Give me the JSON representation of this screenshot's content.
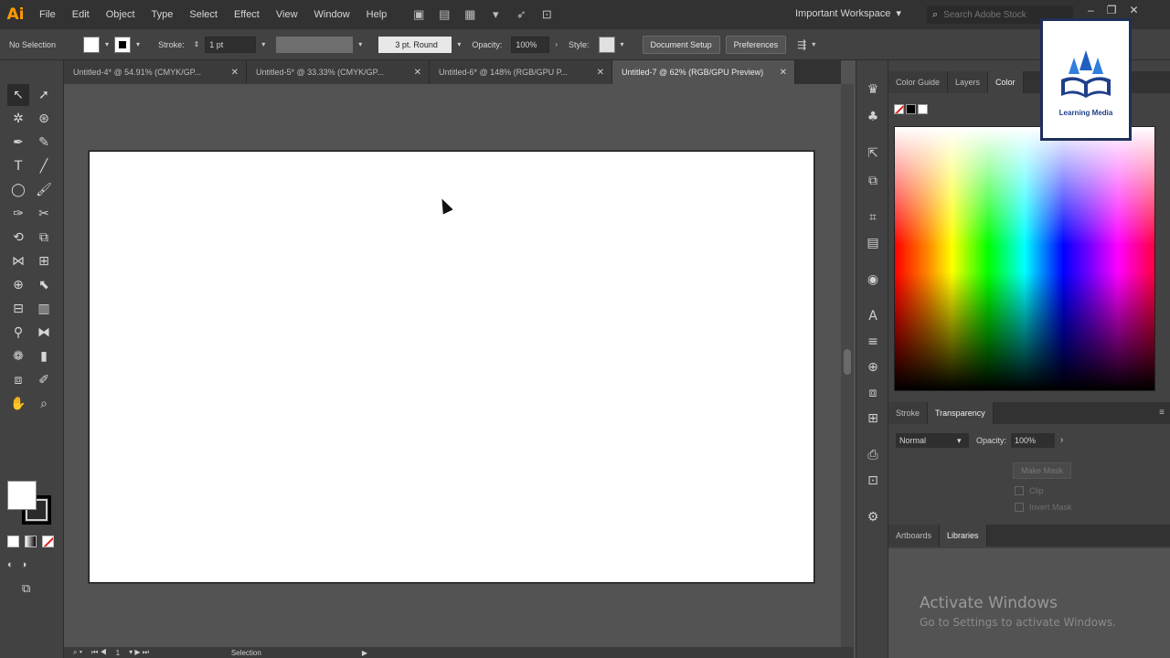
{
  "app": {
    "logo_text": "Ai"
  },
  "menu": {
    "items": [
      "File",
      "Edit",
      "Object",
      "Type",
      "Select",
      "Effect",
      "View",
      "Window",
      "Help"
    ]
  },
  "workspace": {
    "label": "Important Workspace"
  },
  "stock_search": {
    "placeholder": "Search Adobe Stock"
  },
  "control_bar": {
    "selection_label": "No Selection",
    "stroke_label": "Stroke:",
    "stroke_value": "1 pt",
    "profile_label": "3 pt. Round",
    "opacity_label": "Opacity:",
    "opacity_value": "100%",
    "style_label": "Style:",
    "document_setup": "Document Setup",
    "preferences": "Preferences"
  },
  "tabs": [
    {
      "label": "Untitled-4* @ 54.91% (CMYK/GP...",
      "active": false
    },
    {
      "label": "Untitled-5* @ 33.33% (CMYK/GP...",
      "active": false
    },
    {
      "label": "Untitled-6* @ 148% (RGB/GPU P...",
      "active": false
    },
    {
      "label": "Untitled-7 @ 62% (RGB/GPU Preview)",
      "active": true
    }
  ],
  "color_panel": {
    "tabs": [
      "Color Guide",
      "Layers",
      "Color"
    ],
    "active_tab": "Color"
  },
  "transparency_panel": {
    "tabs": [
      "Stroke",
      "Transparency"
    ],
    "blend_mode": "Normal",
    "opacity_label": "Opacity:",
    "opacity_value": "100%",
    "make_mask": "Make Mask",
    "clip_label": "Clip",
    "invert_label": "Invert Mask"
  },
  "libraries_panel": {
    "tabs": [
      "Artboards",
      "Libraries"
    ]
  },
  "status": {
    "tool": "Selection",
    "artboard_number": "1"
  },
  "watermark": {
    "title": "Activate Windows",
    "subtitle": "Go to Settings to activate Windows."
  },
  "logo_overlay": {
    "text": "Learning Media"
  },
  "colors": {
    "accent": "#ff9a00",
    "panel_bg": "#424242",
    "canvas_bg": "#535353",
    "artboard": "#ffffff"
  }
}
